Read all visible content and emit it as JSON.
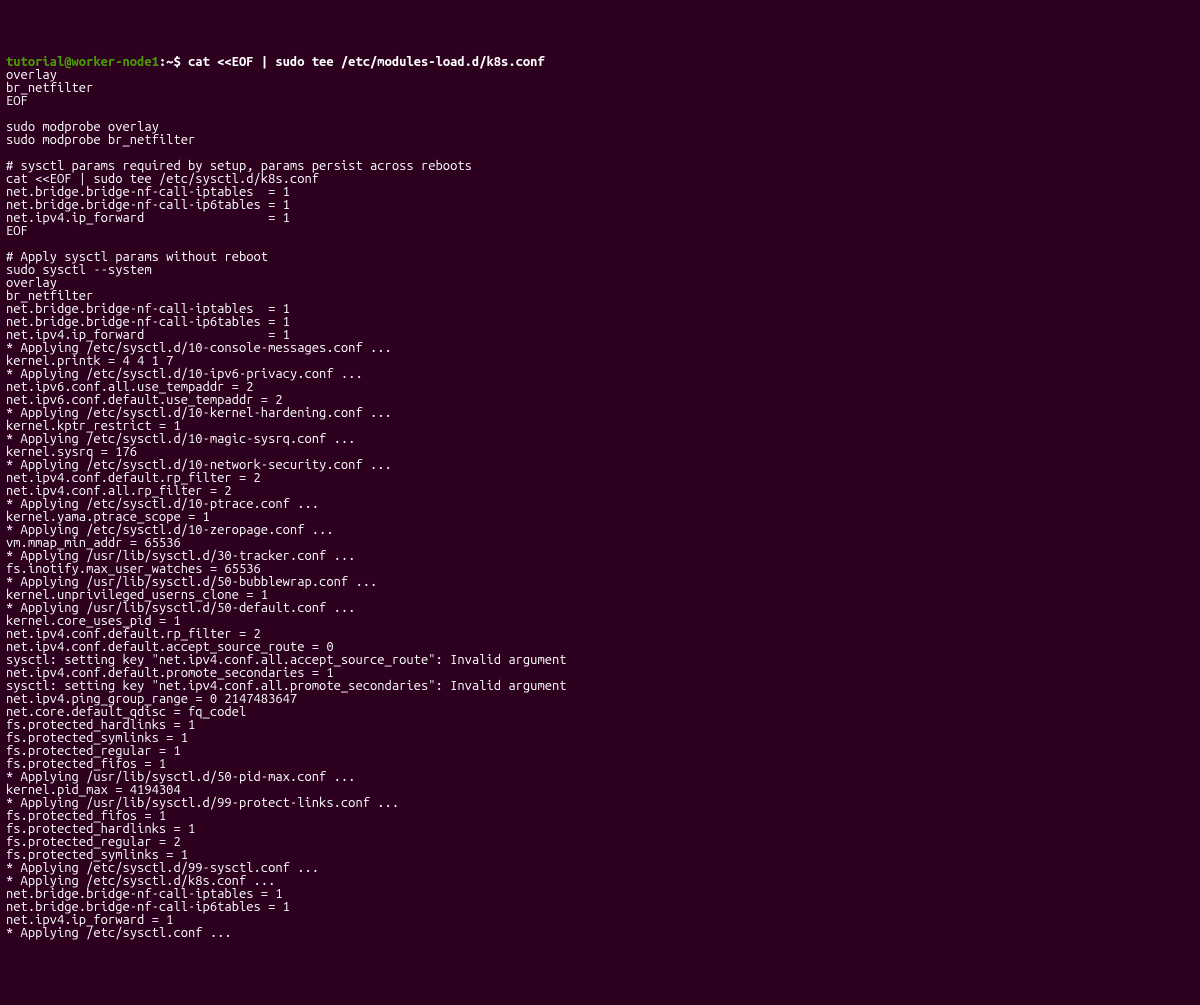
{
  "prompt": {
    "user": "tutorial@worker-node1",
    "sep": ":~$ ",
    "command": "cat <<EOF | sudo tee /etc/modules-load.d/k8s.conf"
  },
  "lines": [
    "overlay",
    "br_netfilter",
    "EOF",
    "",
    "sudo modprobe overlay",
    "sudo modprobe br_netfilter",
    "",
    "# sysctl params required by setup, params persist across reboots",
    "cat <<EOF | sudo tee /etc/sysctl.d/k8s.conf",
    "net.bridge.bridge-nf-call-iptables  = 1",
    "net.bridge.bridge-nf-call-ip6tables = 1",
    "net.ipv4.ip_forward                 = 1",
    "EOF",
    "",
    "# Apply sysctl params without reboot",
    "sudo sysctl --system",
    "overlay",
    "br_netfilter",
    "net.bridge.bridge-nf-call-iptables  = 1",
    "net.bridge.bridge-nf-call-ip6tables = 1",
    "net.ipv4.ip_forward                 = 1",
    "* Applying /etc/sysctl.d/10-console-messages.conf ...",
    "kernel.printk = 4 4 1 7",
    "* Applying /etc/sysctl.d/10-ipv6-privacy.conf ...",
    "net.ipv6.conf.all.use_tempaddr = 2",
    "net.ipv6.conf.default.use_tempaddr = 2",
    "* Applying /etc/sysctl.d/10-kernel-hardening.conf ...",
    "kernel.kptr_restrict = 1",
    "* Applying /etc/sysctl.d/10-magic-sysrq.conf ...",
    "kernel.sysrq = 176",
    "* Applying /etc/sysctl.d/10-network-security.conf ...",
    "net.ipv4.conf.default.rp_filter = 2",
    "net.ipv4.conf.all.rp_filter = 2",
    "* Applying /etc/sysctl.d/10-ptrace.conf ...",
    "kernel.yama.ptrace_scope = 1",
    "* Applying /etc/sysctl.d/10-zeropage.conf ...",
    "vm.mmap_min_addr = 65536",
    "* Applying /usr/lib/sysctl.d/30-tracker.conf ...",
    "fs.inotify.max_user_watches = 65536",
    "* Applying /usr/lib/sysctl.d/50-bubblewrap.conf ...",
    "kernel.unprivileged_userns_clone = 1",
    "* Applying /usr/lib/sysctl.d/50-default.conf ...",
    "kernel.core_uses_pid = 1",
    "net.ipv4.conf.default.rp_filter = 2",
    "net.ipv4.conf.default.accept_source_route = 0",
    "sysctl: setting key \"net.ipv4.conf.all.accept_source_route\": Invalid argument",
    "net.ipv4.conf.default.promote_secondaries = 1",
    "sysctl: setting key \"net.ipv4.conf.all.promote_secondaries\": Invalid argument",
    "net.ipv4.ping_group_range = 0 2147483647",
    "net.core.default_qdisc = fq_codel",
    "fs.protected_hardlinks = 1",
    "fs.protected_symlinks = 1",
    "fs.protected_regular = 1",
    "fs.protected_fifos = 1",
    "* Applying /usr/lib/sysctl.d/50-pid-max.conf ...",
    "kernel.pid_max = 4194304",
    "* Applying /usr/lib/sysctl.d/99-protect-links.conf ...",
    "fs.protected_fifos = 1",
    "fs.protected_hardlinks = 1",
    "fs.protected_regular = 2",
    "fs.protected_symlinks = 1",
    "* Applying /etc/sysctl.d/99-sysctl.conf ...",
    "* Applying /etc/sysctl.d/k8s.conf ...",
    "net.bridge.bridge-nf-call-iptables = 1",
    "net.bridge.bridge-nf-call-ip6tables = 1",
    "net.ipv4.ip_forward = 1",
    "* Applying /etc/sysctl.conf ..."
  ]
}
